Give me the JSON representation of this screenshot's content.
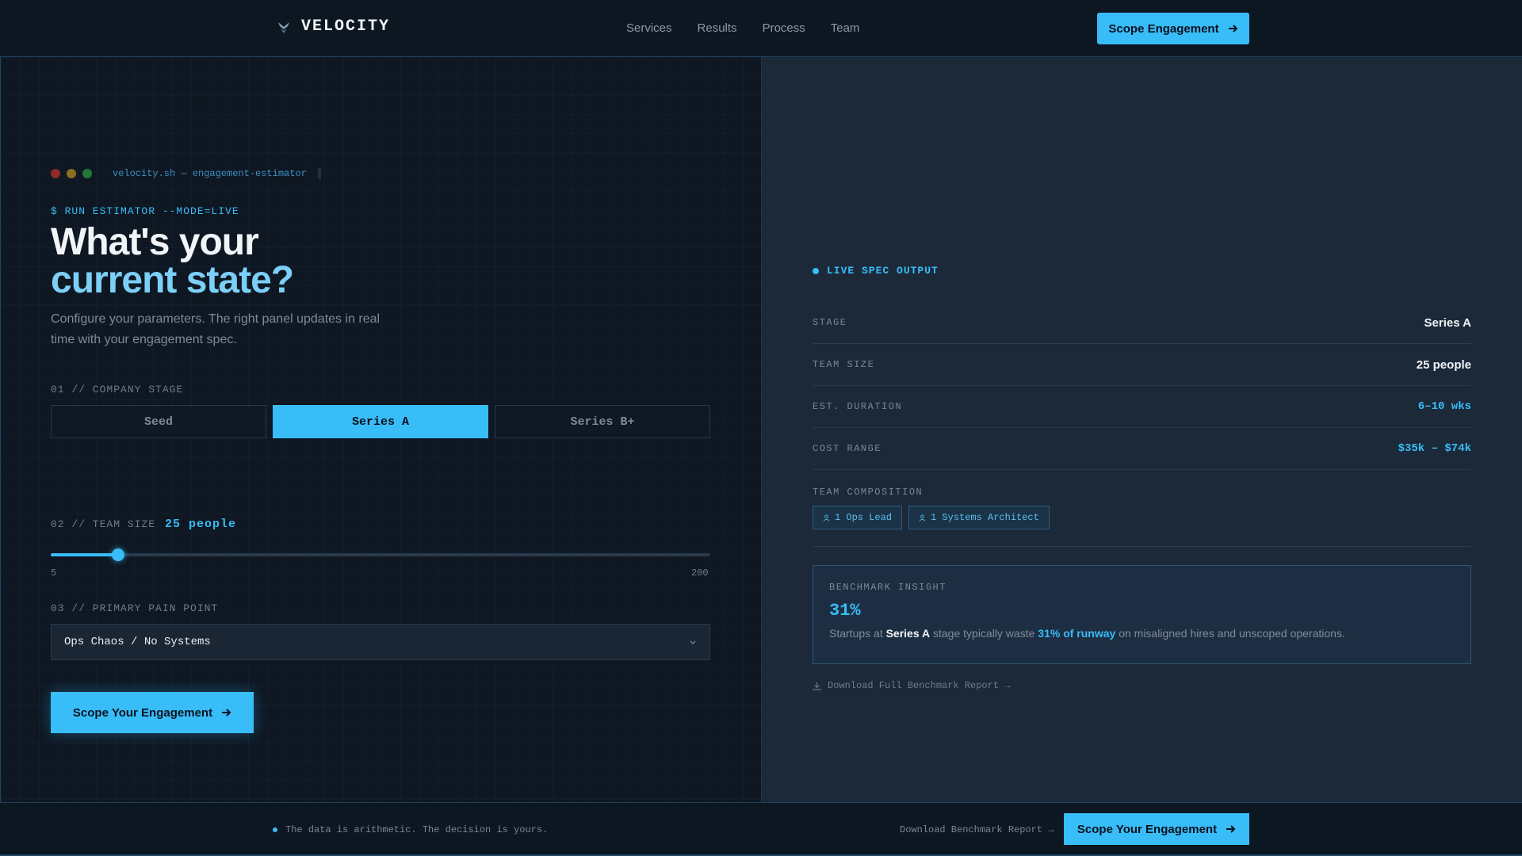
{
  "header": {
    "brand": "VELOCITY",
    "nav": [
      "Services",
      "Results",
      "Process",
      "Team"
    ],
    "cta": "Scope Engagement"
  },
  "terminal": {
    "title": "velocity.sh — engagement-estimator",
    "dot_colors": [
      "#c0392b",
      "#c9a227",
      "#27ae60"
    ]
  },
  "hero": {
    "prompt": "$ RUN ESTIMATOR --MODE=LIVE",
    "headline_line1": "What's your",
    "headline_line2": "current state?",
    "subtext": "Configure your parameters. The right panel updates in real time with your engagement spec."
  },
  "form": {
    "stage_label": "01 // COMPANY STAGE",
    "stages": [
      "Seed",
      "Series A",
      "Series B+"
    ],
    "selected_stage": "Series A",
    "team_label": "02 // TEAM SIZE",
    "team_value": "25 people",
    "slider": {
      "min": "5",
      "max": "200",
      "value": 25,
      "min_num": 5,
      "max_num": 200
    },
    "pain_label": "03 // PRIMARY PAIN POINT",
    "pain_value": "Ops Chaos / No Systems",
    "cta": "Scope Your Engagement"
  },
  "spec": {
    "header": "LIVE SPEC OUTPUT",
    "rows": [
      {
        "key": "STAGE",
        "value": "Series A"
      },
      {
        "key": "TEAM SIZE",
        "value": "25 people"
      },
      {
        "key": "EST. DURATION",
        "value": "6–10 wks"
      },
      {
        "key": "COST RANGE",
        "value": "$35k – $74k"
      }
    ],
    "composition_label": "TEAM COMPOSITION",
    "composition": [
      "1 Ops Lead",
      "1 Systems Architect"
    ]
  },
  "benchmark": {
    "label": "BENCHMARK INSIGHT",
    "pct": "31%",
    "text_pre": "Startups at ",
    "stage": "Series A",
    "text_mid": " stage typically waste ",
    "runway": "31% of runway",
    "text_post": " on misaligned hires and unscoped operations.",
    "download": "Download Full Benchmark Report →"
  },
  "footer": {
    "note": "The data is arithmetic. The decision is yours.",
    "link": "Download Benchmark Report →",
    "cta": "Scope Your Engagement"
  },
  "colors": {
    "accent": "#38bdf8",
    "background": "#0d1520",
    "panel": "#1c2939"
  },
  "icons": [
    "logo-icon",
    "arrow-right-icon",
    "chevron-down-icon",
    "user-icon",
    "download-icon"
  ]
}
